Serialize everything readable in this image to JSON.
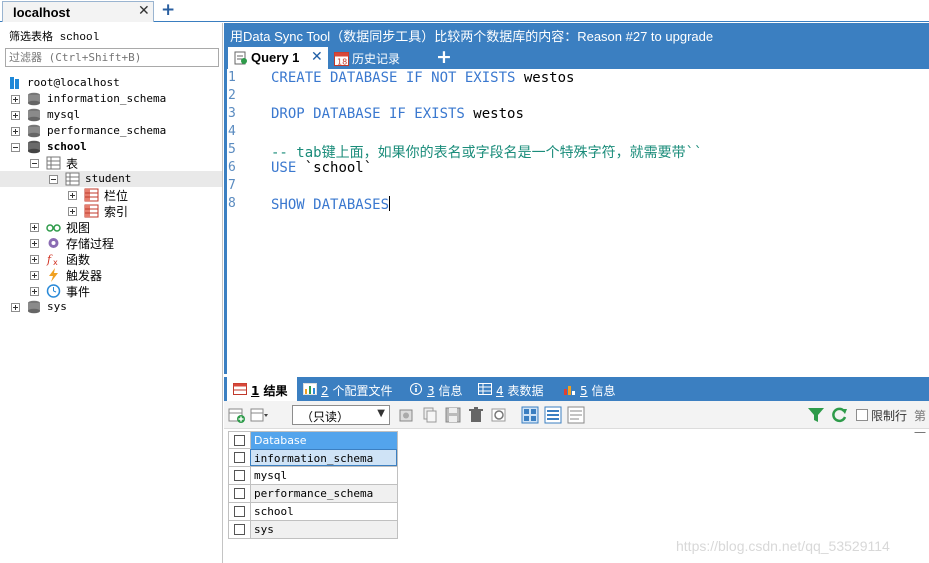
{
  "top_tabs": {
    "connection_tab": "localhost",
    "close_glyph": "✕",
    "new_tab_glyph": "+"
  },
  "left_panel": {
    "filter_label": "筛选表格 school",
    "filter_placeholder": "过滤器 (Ctrl+Shift+B)",
    "tree": {
      "root": "root@localhost",
      "dbs": [
        "information_schema",
        "mysql",
        "performance_schema"
      ],
      "school": "school",
      "tables_folder": "表",
      "student": "student",
      "columns": "栏位",
      "indexes": "索引",
      "views": "视图",
      "procedures": "存储过程",
      "functions": "函数",
      "triggers": "触发器",
      "events": "事件",
      "sys": "sys"
    }
  },
  "main": {
    "info_bar": "用Data Sync Tool（数据同步工具）比较两个数据库的内容：Reason #27 to upgrade",
    "query_tab": "Query 1",
    "history_tab": "历史记录",
    "history_icon_day": "18",
    "add_tab_glyph": "+",
    "editor": {
      "line_numbers": [
        "1",
        "2",
        "3",
        "4",
        "5",
        "6",
        "7",
        "8"
      ],
      "l1_kw": "CREATE DATABASE IF NOT EXISTS",
      "l1_name": " westos",
      "l3_kw": "DROP DATABASE IF EXISTS",
      "l3_name": " westos",
      "l5_comment": "-- tab键上面，如果你的表名或字段名是一个特殊字符，就需要带``",
      "l6_kw": "USE",
      "l6_name": " `school`",
      "l8_kw": "SHOW DATABASES"
    },
    "result_tabs": [
      {
        "num": "1",
        "label": " 结果"
      },
      {
        "num": "2",
        "label": " 个配置文件"
      },
      {
        "num": "3",
        "label": " 信息"
      },
      {
        "num": "4",
        "label": " 表数据"
      },
      {
        "num": "5",
        "label": " 信息"
      }
    ],
    "toolbar": {
      "readonly_value": "（只读）",
      "limit_rows_label": "限制行",
      "page_label": "第一"
    },
    "grid": {
      "header": "Database",
      "rows": [
        "information_schema",
        "mysql",
        "performance_schema",
        "school",
        "sys"
      ]
    }
  },
  "watermark": "https://blog.csdn.net/qq_53529114",
  "colors": {
    "accent_blue": "#3b7fc1",
    "keyword_blue": "#3a78cf",
    "comment_teal": "#1a8c7a",
    "grid_header": "#53a4ec"
  }
}
